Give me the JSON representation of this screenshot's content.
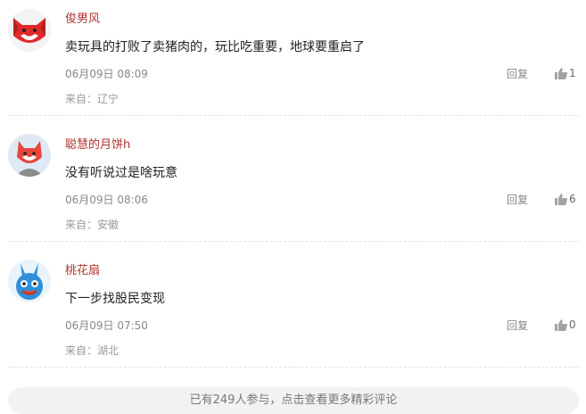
{
  "comments": [
    {
      "name": "俊男风",
      "content": "卖玩具的打败了卖猪肉的，玩比吃重要，地球要重启了",
      "time": "06月09日 08:09",
      "location": "来自：辽宁",
      "reply_label": "回复",
      "likes": "1",
      "avatar_icon": "red-fox-avatar"
    },
    {
      "name": "聪慧的月饼h",
      "content": "没有听说过是啥玩意",
      "time": "06月09日 08:06",
      "location": "来自：安徽",
      "reply_label": "回复",
      "likes": "6",
      "avatar_icon": "fox-grey-suit-avatar"
    },
    {
      "name": "桃花扇",
      "content": "下一步找股民变现",
      "time": "06月09日 07:50",
      "location": "来自：湖北",
      "reply_label": "回复",
      "likes": "0",
      "avatar_icon": "blue-rabbit-avatar"
    }
  ],
  "more_button": "已有249人参与，点击查看更多精彩评论",
  "colors": {
    "name": "#b0322d",
    "divider": "#e3e3e3",
    "more_bg": "#f2f2f2"
  }
}
